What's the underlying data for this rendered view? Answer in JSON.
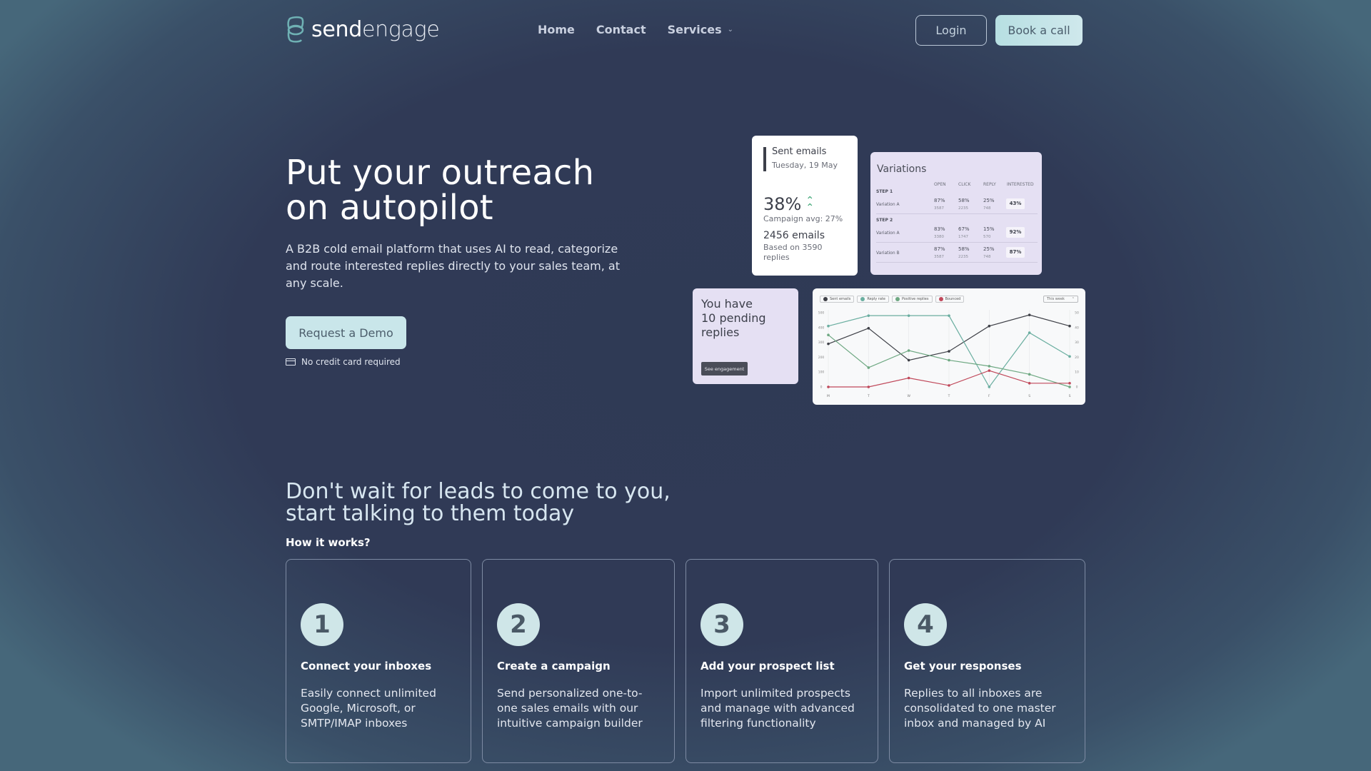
{
  "brand": {
    "name_bold": "send",
    "name_light": "engage",
    "accent": "#6fb1b4"
  },
  "nav": {
    "items": [
      {
        "label": "Home"
      },
      {
        "label": "Contact"
      },
      {
        "label": "Services",
        "has_dropdown": true
      }
    ],
    "chevron_icon": "chevron-down-icon",
    "login_label": "Login",
    "book_label": "Book a call"
  },
  "hero": {
    "title_line1": "Put your outreach",
    "title_line2": "on autopilot",
    "subtitle": "A B2B cold email platform that uses AI to read, categorize and route interested replies directly to your sales team, at any scale.",
    "cta_label": "Request a Demo",
    "note": "No credit card required",
    "note_icon": "credit-card-icon"
  },
  "sent_card": {
    "title": "Sent emails",
    "date": "Tuesday, 19 May",
    "percent": "38%",
    "trend_icon": "double-chevron-up-icon",
    "campaign_avg": "Campaign avg: 27%",
    "emails": "2456 emails",
    "based_on": "Based on 3590 replies"
  },
  "variations": {
    "title": "Variations",
    "columns": [
      "OPEN",
      "CLICK",
      "REPLY",
      "INTERESTED"
    ],
    "steps": [
      {
        "label": "STEP 1",
        "rows": [
          {
            "name": "Variation A",
            "open": "87%",
            "open_n": "3587",
            "click": "58%",
            "click_n": "2235",
            "reply": "25%",
            "reply_n": "748",
            "interested": "43%"
          }
        ]
      },
      {
        "label": "STEP 2",
        "rows": [
          {
            "name": "Variation A",
            "open": "83%",
            "open_n": "3380",
            "click": "67%",
            "click_n": "1747",
            "reply": "15%",
            "reply_n": "570",
            "interested": "92%"
          },
          {
            "name": "Variation B",
            "open": "87%",
            "open_n": "3587",
            "click": "58%",
            "click_n": "2235",
            "reply": "25%",
            "reply_n": "748",
            "interested": "87%"
          }
        ]
      }
    ]
  },
  "pending": {
    "text_line1": "You have",
    "text_line2": "10 pending",
    "text_line3": "replies",
    "button_label": "See engagement"
  },
  "chart_filter": {
    "selected": "This week",
    "icon": "chevron-up-icon"
  },
  "chart_data": {
    "type": "line",
    "title": "",
    "x": [
      "M",
      "T",
      "W",
      "T",
      "F",
      "S",
      "S"
    ],
    "y_left": {
      "ticks": [
        0,
        100,
        200,
        300,
        400,
        500
      ],
      "ylim": [
        0,
        500
      ]
    },
    "y_right": {
      "ticks": [
        0,
        10,
        20,
        30,
        40,
        50
      ],
      "ylim": [
        0,
        50
      ]
    },
    "grid": "vertical",
    "legend_position": "top-left",
    "series": [
      {
        "name": "Sent emails",
        "color": "#3d3f46",
        "values": [
          290,
          395,
          180,
          240,
          410,
          485,
          410
        ]
      },
      {
        "name": "Reply rate",
        "color": "#6aaea0",
        "values": [
          410,
          480,
          480,
          480,
          0,
          365,
          205
        ]
      },
      {
        "name": "Positive replies",
        "color": "#6ea882",
        "values": [
          350,
          130,
          245,
          180,
          140,
          85,
          0
        ]
      },
      {
        "name": "Bounced",
        "color": "#c0485a",
        "values": [
          0,
          0,
          60,
          10,
          110,
          25,
          25
        ]
      }
    ]
  },
  "section2": {
    "title_line1": "Don't wait for leads to come to you,",
    "title_line2": "start talking to them today",
    "how_label": "How it works?",
    "steps": [
      {
        "num": "1",
        "title": "Connect your inboxes",
        "desc": "Easily connect unlimited Google, Microsoft, or SMTP/IMAP inboxes"
      },
      {
        "num": "2",
        "title": "Create a campaign",
        "desc": "Send personalized one-to-one sales emails with our intuitive campaign builder"
      },
      {
        "num": "3",
        "title": "Add your prospect list",
        "desc": "Import unlimited prospects and manage with advanced filtering functionality"
      },
      {
        "num": "4",
        "title": "Get your responses",
        "desc": "Replies to all inboxes are consolidated to one master inbox and managed by AI"
      }
    ]
  }
}
